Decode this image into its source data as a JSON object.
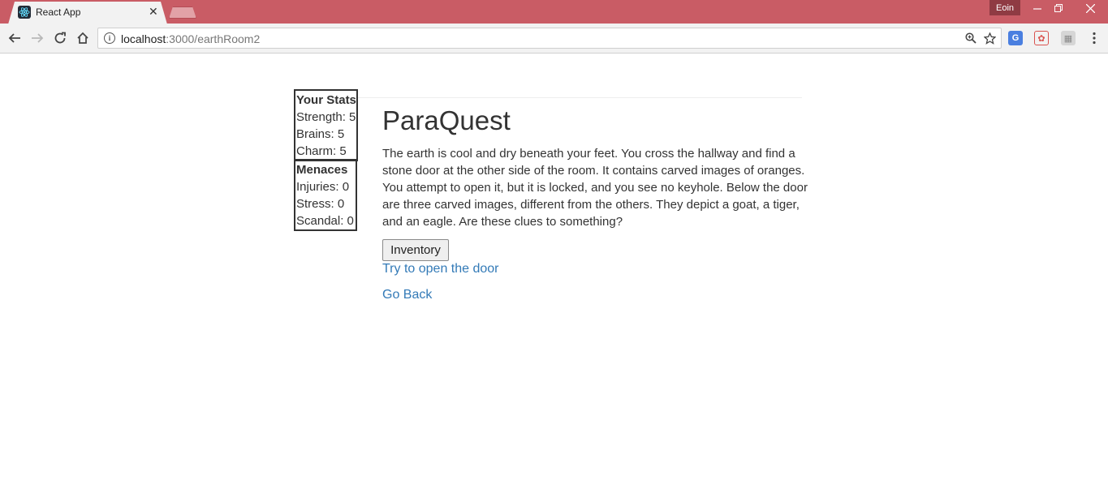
{
  "browser": {
    "tab_title": "React App",
    "tab_close": "✕",
    "user_name": "Eoin",
    "url_host": "localhost",
    "url_path": ":3000/earthRoom2",
    "colors": {
      "titlebar": "#c95c65",
      "link": "#337ab7"
    }
  },
  "icons": {
    "back": "back-arrow-icon",
    "forward": "forward-arrow-icon",
    "reload": "reload-icon",
    "home": "home-icon",
    "info": "info-icon",
    "zoom": "zoom-icon",
    "star": "bookmark-star-icon",
    "menu": "kebab-menu-icon"
  },
  "stats": {
    "heading": "Your Stats",
    "strength": "Strength: 5",
    "brains": "Brains: 5",
    "charm": "Charm: 5"
  },
  "menaces": {
    "heading": "Menaces",
    "injuries": "Injuries: 0",
    "stress": "Stress: 0",
    "scandal": "Scandal: 0"
  },
  "main": {
    "title": "ParaQuest",
    "story": "The earth is cool and dry beneath your feet. You cross the hallway and find a stone door at the other side of the room. It contains carved images of oranges. You attempt to open it, but it is locked, and you see no keyhole. Below the door are three carved images, different from the others. They depict a goat, a tiger, and an eagle. Are these clues to something?",
    "inventory_button": "Inventory",
    "open_door_link": "Try to open the door",
    "go_back_link": "Go Back"
  }
}
